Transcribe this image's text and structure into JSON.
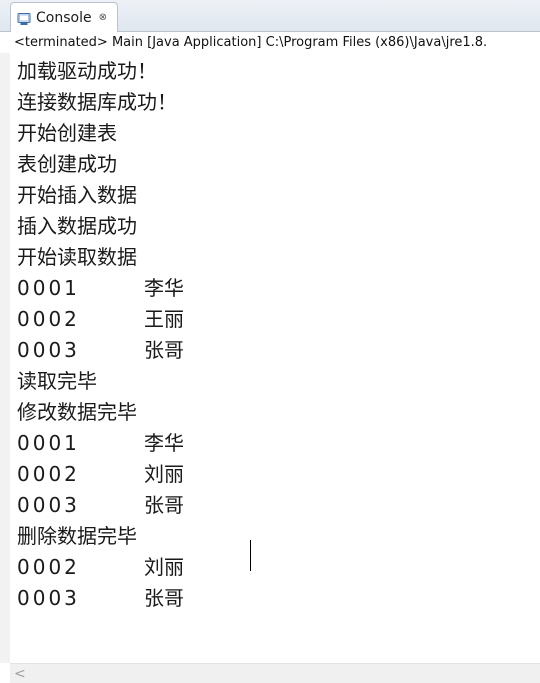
{
  "tab": {
    "icon": "console-icon",
    "label": "Console",
    "close_glyph": "⊗"
  },
  "status": "<terminated> Main [Java Application] C:\\Program Files (x86)\\Java\\jre1.8.",
  "output_lines": [
    {
      "text": "加载驱动成功！"
    },
    {
      "text": "连接数据库成功！"
    },
    {
      "text": "开始创建表"
    },
    {
      "text": "表创建成功"
    },
    {
      "text": "开始插入数据"
    },
    {
      "text": "插入数据成功"
    },
    {
      "text": "开始读取数据"
    },
    {
      "id": "0001",
      "name": "李华"
    },
    {
      "id": "0002",
      "name": "王丽"
    },
    {
      "id": "0003",
      "name": "张哥"
    },
    {
      "text": "读取完毕"
    },
    {
      "text": "修改数据完毕"
    },
    {
      "id": "0001",
      "name": "李华"
    },
    {
      "id": "0002",
      "name": "刘丽"
    },
    {
      "id": "0003",
      "name": "张哥"
    },
    {
      "text": "删除数据完毕"
    },
    {
      "id": "0002",
      "name": "刘丽"
    },
    {
      "id": "0003",
      "name": "张哥"
    }
  ],
  "scrollbar": {
    "left_arrow": "<"
  }
}
